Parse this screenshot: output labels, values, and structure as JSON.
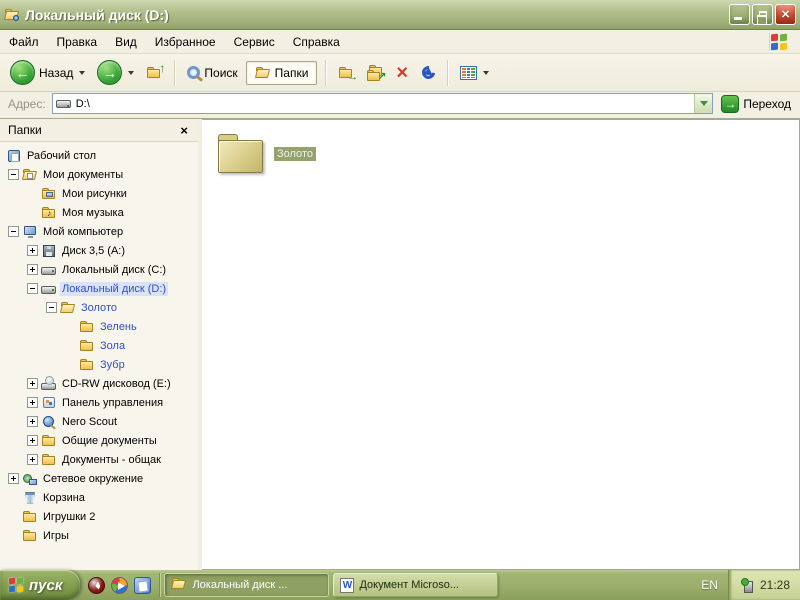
{
  "window": {
    "title": "Локальный диск (D:)"
  },
  "icons": {
    "titlebar": [
      "explorer-folder-icon",
      "minimize-icon",
      "restore-icon",
      "close-icon"
    ],
    "toolbar": [
      "back-icon",
      "forward-icon",
      "up-icon",
      "search-icon",
      "folders-icon",
      "move-to-icon",
      "copy-to-icon",
      "delete-icon",
      "undo-icon",
      "views-icon"
    ],
    "close_glyph": "×",
    "back_glyph": "←",
    "forward_glyph": "→"
  },
  "menu": {
    "items": [
      "Файл",
      "Правка",
      "Вид",
      "Избранное",
      "Сервис",
      "Справка"
    ]
  },
  "toolbar": {
    "back": "Назад",
    "search": "Поиск",
    "folders": "Папки"
  },
  "addressbar": {
    "label": "Адрес:",
    "value": "D:\\",
    "go": "Переход"
  },
  "folders_pane": {
    "title": "Папки",
    "tree": [
      {
        "label": "Рабочий стол",
        "icon": "desktop",
        "level": 0,
        "exp": ""
      },
      {
        "label": "Мои документы",
        "icon": "folder-docs",
        "level": 1,
        "exp": "minus"
      },
      {
        "label": "Мои рисунки",
        "icon": "folder-pictures",
        "level": 2,
        "exp": ""
      },
      {
        "label": "Моя музыка",
        "icon": "folder-music",
        "level": 2,
        "exp": ""
      },
      {
        "label": "Мой компьютер",
        "icon": "computer",
        "level": 1,
        "exp": "minus"
      },
      {
        "label": "Диск 3,5 (A:)",
        "icon": "floppy",
        "level": 2,
        "exp": "plus"
      },
      {
        "label": "Локальный диск (C:)",
        "icon": "drive",
        "level": 2,
        "exp": "plus"
      },
      {
        "label": "Локальный диск (D:)",
        "icon": "drive",
        "level": 2,
        "exp": "minus",
        "blue": true,
        "selected": true
      },
      {
        "label": "Золото",
        "icon": "folder-open",
        "level": 3,
        "exp": "minus",
        "blue": true
      },
      {
        "label": "Зелень",
        "icon": "folder",
        "level": 4,
        "exp": "",
        "blue": true
      },
      {
        "label": "Зола",
        "icon": "folder",
        "level": 4,
        "exp": "",
        "blue": true
      },
      {
        "label": "Зубр",
        "icon": "folder",
        "level": 4,
        "exp": "",
        "blue": true
      },
      {
        "label": "CD-RW дисковод (E:)",
        "icon": "cd-drive",
        "level": 2,
        "exp": "plus"
      },
      {
        "label": "Панель управления",
        "icon": "control-panel",
        "level": 2,
        "exp": "plus"
      },
      {
        "label": "Nero Scout",
        "icon": "nero-scout",
        "level": 2,
        "exp": "plus"
      },
      {
        "label": "Общие документы",
        "icon": "folder",
        "level": 2,
        "exp": "plus"
      },
      {
        "label": "Документы - общак",
        "icon": "folder",
        "level": 2,
        "exp": "plus"
      },
      {
        "label": "Сетевое окружение",
        "icon": "network",
        "level": 1,
        "exp": "plus"
      },
      {
        "label": "Корзина",
        "icon": "recycle-bin",
        "level": 1,
        "exp": ""
      },
      {
        "label": "Игрушки 2",
        "icon": "folder",
        "level": 1,
        "exp": ""
      },
      {
        "label": "Игры",
        "icon": "folder",
        "level": 1,
        "exp": ""
      }
    ]
  },
  "content": {
    "items": [
      {
        "label": "Золото",
        "icon": "folder-large",
        "selected": true
      }
    ]
  },
  "taskbar": {
    "start": "пуск",
    "quicklaunch": [
      "nero-icon",
      "media-player-icon",
      "show-desktop-icon"
    ],
    "buttons": [
      {
        "label": "Локальный диск ...",
        "icon": "folder-icon",
        "active": true
      },
      {
        "label": "Документ Microso...",
        "icon": "word-icon",
        "active": false
      }
    ],
    "tray": {
      "language": "EN",
      "icon": "safely-remove-hardware-icon",
      "time": "21:28"
    }
  },
  "colors": {
    "titlebar_top": "#cdd7ae",
    "titlebar_bottom": "#8da068",
    "selection_olive": "#94a36e",
    "selection_tree": "#d9e2f7",
    "link_blue": "#3050c8",
    "taskbar": "#9cae6c",
    "close_red": "#cf4931"
  }
}
